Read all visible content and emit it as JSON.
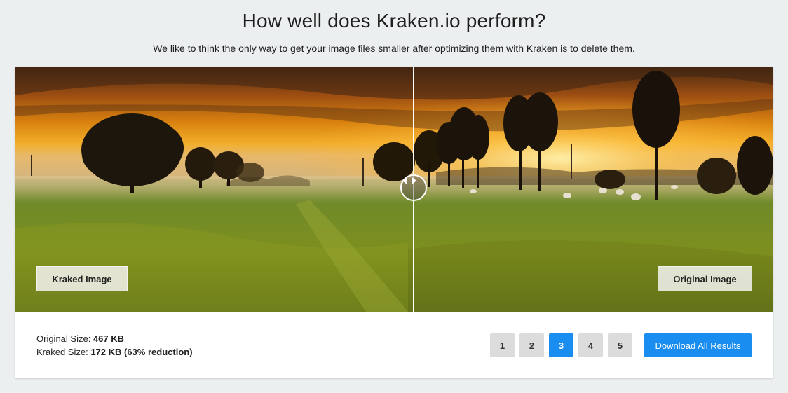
{
  "header": {
    "title": "How well does Kraken.io perform?",
    "subtitle": "We like to think the only way to get your image files smaller after optimizing them with Kraken is to delete them."
  },
  "viewer": {
    "left_label": "Kraked Image",
    "right_label": "Original Image",
    "split_position_percent": 52.6
  },
  "stats": {
    "original_label": "Original Size:",
    "original_value": "467 KB",
    "kraked_label": "Kraked Size:",
    "kraked_value": "172 KB (63% reduction)"
  },
  "pagination": {
    "pages": [
      "1",
      "2",
      "3",
      "4",
      "5"
    ],
    "active_page": "3"
  },
  "actions": {
    "download_label": "Download All Results"
  },
  "colors": {
    "accent": "#1a8df0",
    "button_gray": "#dcdcdc",
    "background": "#eceff0"
  }
}
